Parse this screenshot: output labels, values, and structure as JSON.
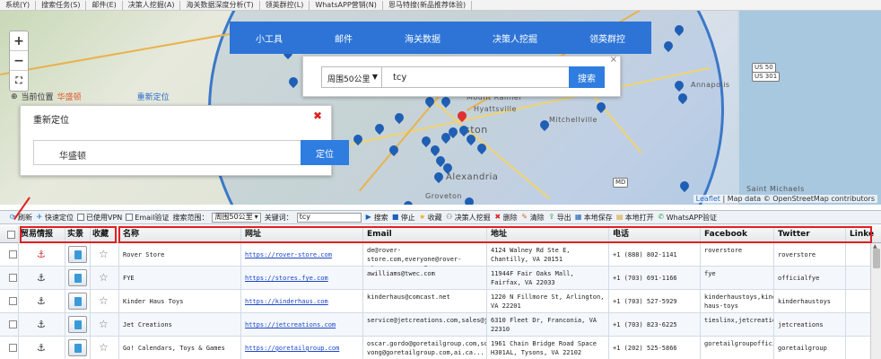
{
  "menubar": [
    "系统(Y)",
    "搜索任务(S)",
    "邮件(E)",
    "决策人挖掘(A)",
    "海关数据深度分析(T)",
    "领英群控(L)",
    "WhatsAPP营销(N)",
    "恩马特搜(新品推荐体验)"
  ],
  "map": {
    "zoom_in": "+",
    "zoom_out": "−",
    "fullscreen": "⛶",
    "locate_label": "当前位置",
    "locate_value": "华盛顿",
    "relocate_link": "重新定位",
    "relocate_panel": {
      "title": "重新定位",
      "close": "✖",
      "input_value": "华盛顿",
      "button": "定位"
    },
    "nav_tabs": [
      "小工具",
      "邮件",
      "海关数据",
      "决策人挖掘",
      "领英群控"
    ],
    "search": {
      "range_select": "周围50公里",
      "query": "tcy",
      "button": "搜索",
      "close": "×"
    },
    "labels": {
      "mount_rainier": "Mount Rainier",
      "hyattsville": "Hyattsville",
      "mitchellville": "Mitchellville",
      "washington": "ston",
      "alexandria": "Alexandria",
      "groveton": "Groveton",
      "saint_michaels": "Saint Michaels",
      "annapolis": "Annapolis"
    },
    "shields": [
      "US 50",
      "US 301",
      "MD"
    ],
    "attribution": {
      "leaflet": "Leaflet",
      "rest": "| Map data © OpenStreetMap contributors"
    }
  },
  "toolbar": {
    "refresh": "刷新",
    "quick_locate": "快速定位",
    "vpn": "已使用VPN",
    "email_verify": "Email验证",
    "range_label": "搜索范围：",
    "range_value": "周围50公里",
    "keyword_label": "关键词：",
    "keyword_value": "tcy",
    "search": "搜索",
    "stop": "停止",
    "collect": "收藏",
    "decision_mining": "决策人挖掘",
    "delete": "删除",
    "clear": "清除",
    "export": "导出",
    "save_local": "本地保存",
    "open_local": "本地打开",
    "whatsapp_verify": "WhatsAPP验证"
  },
  "table": {
    "headers": [
      "贸易情报",
      "实景",
      "收藏",
      "名称",
      "网址",
      "Email",
      "地址",
      "电话",
      "Facebook",
      "Twitter",
      "Linke"
    ],
    "rows": [
      {
        "name": "Rover Store",
        "url": "https://rover-store.com",
        "email": "de@rover-store.com,everyone@rover-store.com,rover@rover-store.com",
        "address": "4124 Walney Rd Ste E, Chantilly, VA 20151",
        "phone": "+1 (888) 802-1141",
        "facebook": "roverstore",
        "twitter": "roverstore",
        "anchor_red": true
      },
      {
        "name": "FYE",
        "url": "https://stores.fye.com",
        "email": "awilliams@twec.com",
        "address": "11944F Fair Oaks Mall, Fairfax, VA 22033",
        "phone": "+1 (703) 691-1166",
        "facebook": "fye",
        "twitter": "officialfye",
        "anchor_red": false
      },
      {
        "name": "Kinder Haus Toys",
        "url": "https://kinderhaus.com",
        "email": "kinderhaus@comcast.net",
        "address": "1220 N Fillmore St, Arlington, VA 22201",
        "phone": "+1 (703) 527-5929",
        "facebook": "kinderhaustoys,kinder-haus-toys",
        "twitter": "kinderhaustoys",
        "anchor_red": false
      },
      {
        "name": "Jet Creations",
        "url": "https://jetcreations.com",
        "email": "service@jetcreations.com,sales@jetcreations.com,atoussaj@jetcr...",
        "address": "6310 Fleet Dr, Franconia, VA 22310",
        "phone": "+1 (703) 823-6225",
        "facebook": "tieslinx,jetcreations",
        "twitter": "jetcreations",
        "anchor_red": false
      },
      {
        "name": "Go! Calendars, Toys & Games",
        "url": "https://goretailgroup.com",
        "email": "oscar.gordo@goretailgroup.com,sorcy-vong@goretailgroup.com,ai.ca...",
        "address": "1961 Chain Bridge Road Space H301AL, Tysons, VA 22102",
        "phone": "+1 (202) 525-5866",
        "facebook": "goretailgroupofficial,goretailgroup",
        "twitter": "goretailgroup",
        "anchor_red": false
      }
    ]
  }
}
